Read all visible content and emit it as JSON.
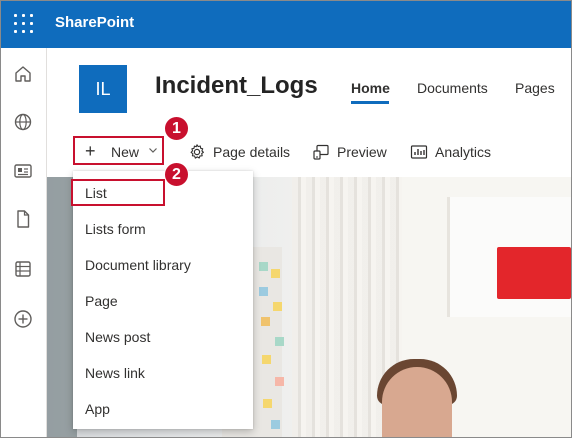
{
  "suite": {
    "brand": "SharePoint"
  },
  "site": {
    "logo_initials": "IL",
    "title": "Incident_Logs",
    "nav": [
      "Home",
      "Documents",
      "Pages"
    ]
  },
  "command_bar": {
    "new_label": "New",
    "page_details_label": "Page details",
    "preview_label": "Preview",
    "analytics_label": "Analytics"
  },
  "new_menu": {
    "items": [
      "List",
      "Lists form",
      "Document library",
      "Page",
      "News post",
      "News link",
      "App"
    ]
  },
  "annotations": {
    "step1": "1",
    "step2": "2"
  },
  "colors": {
    "brand_blue": "#0f6cbd",
    "callout_red": "#c8102e"
  },
  "rail_icons": [
    "home-icon",
    "globe-icon",
    "news-icon",
    "document-icon",
    "lists-icon",
    "create-icon"
  ]
}
